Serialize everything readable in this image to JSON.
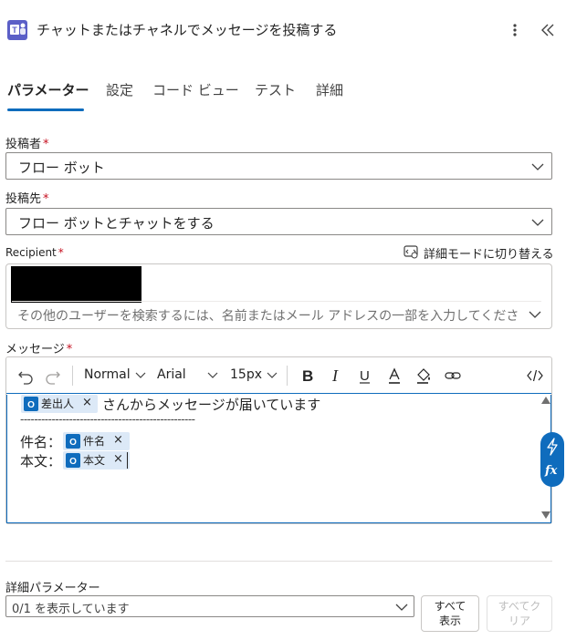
{
  "header": {
    "title": "チャットまたはチャネルでメッセージを投稿する",
    "app_icon": "teams-icon",
    "more_icon": "more-vertical-icon",
    "collapse_icon": "double-chevron-left-icon"
  },
  "tabs": [
    {
      "label": "パラメーター",
      "active": true
    },
    {
      "label": "設定"
    },
    {
      "label": "コード ビュー"
    },
    {
      "label": "テスト"
    },
    {
      "label": "詳細"
    }
  ],
  "fields": {
    "poster": {
      "label": "投稿者",
      "required": "*",
      "value": "フロー ボット"
    },
    "post_in": {
      "label": "投稿先",
      "required": "*",
      "value": "フロー ボットとチャットをする"
    },
    "recipient": {
      "label": "Recipient",
      "required": "*",
      "placeholder": "その他のユーザーを検索するには、名前またはメール アドレスの一部を入力してくださ"
    },
    "advanced_mode": {
      "label": "詳細モードに切り替える"
    },
    "message": {
      "label": "メッセージ",
      "required": "*"
    }
  },
  "toolbar": {
    "style": "Normal",
    "font": "Arial",
    "size": "15px",
    "icons": [
      "undo-icon",
      "redo-icon",
      "bold-icon",
      "italic-icon",
      "underline-icon",
      "font-color-icon",
      "highlight-icon",
      "link-icon",
      "code-view-icon"
    ]
  },
  "message_body": {
    "token_sender": "差出人",
    "line1_text": "さんからメッセージが届いています",
    "separator": "--------------------------------------------------",
    "subject_label": "件名：",
    "token_subject": "件名",
    "body_label": "本文：",
    "token_body": "本文",
    "close_mark": "×"
  },
  "advanced_params": {
    "label": "詳細パラメーター",
    "value": "0/1 を表示しています",
    "show_all": "すべて\n表示",
    "show_all_l1": "すべて",
    "show_all_l2": "表示",
    "clear_all_l1": "すべてク",
    "clear_all_l2": "リア"
  },
  "colors": {
    "accent": "#0f6cbd",
    "required": "#c50f1f",
    "token_bg": "#dce9f7"
  }
}
